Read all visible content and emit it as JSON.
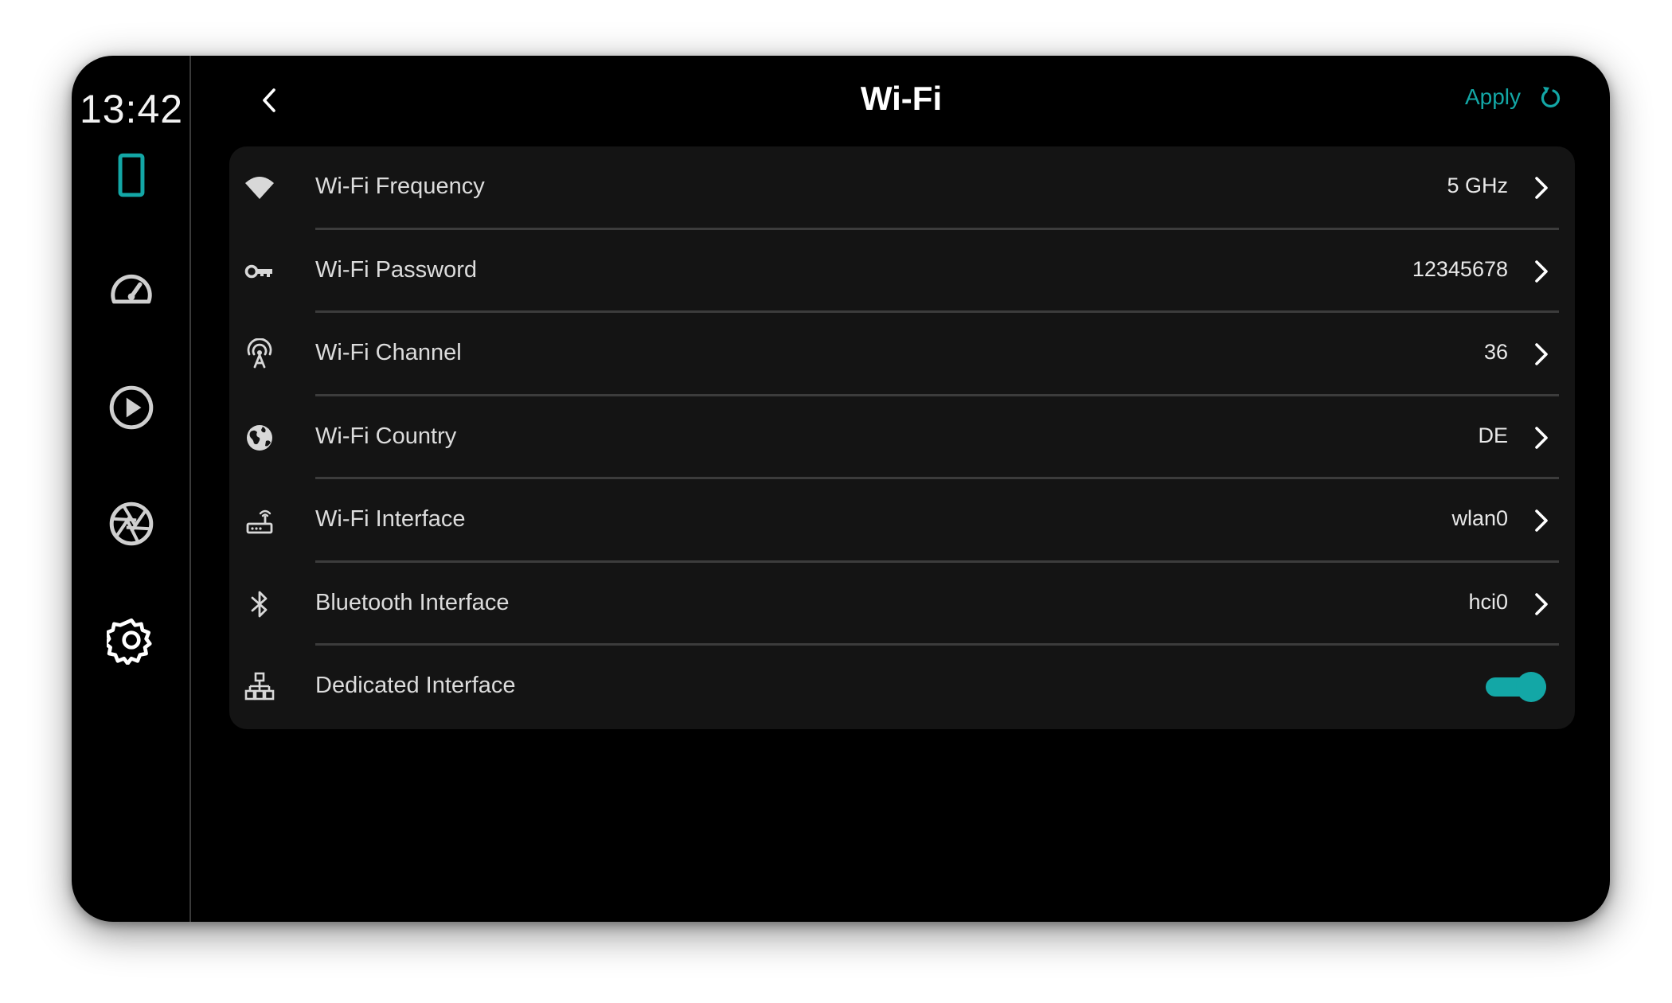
{
  "clock": "13:42",
  "accent_color": "#13a7a6",
  "rail": {
    "items": [
      {
        "icon": "tablet-icon",
        "active": true
      },
      {
        "icon": "speedometer-icon",
        "active": false
      },
      {
        "icon": "play-circle-icon",
        "active": false
      },
      {
        "icon": "camera-aperture-icon",
        "active": false
      },
      {
        "icon": "gear-icon",
        "active": false
      }
    ]
  },
  "header": {
    "title": "Wi-Fi",
    "back_icon": "chevron-left-icon",
    "apply_label": "Apply",
    "apply_icon": "refresh-icon"
  },
  "settings": {
    "rows": [
      {
        "icon": "wifi-icon",
        "label": "Wi-Fi Frequency",
        "value": "5 GHz"
      },
      {
        "icon": "key-icon",
        "label": "Wi-Fi Password",
        "value": "12345678"
      },
      {
        "icon": "broadcast-tower-icon",
        "label": "Wi-Fi Channel",
        "value": "36"
      },
      {
        "icon": "globe-icon",
        "label": "Wi-Fi Country",
        "value": "DE"
      },
      {
        "icon": "router-icon",
        "label": "Wi-Fi Interface",
        "value": "wlan0"
      },
      {
        "icon": "bluetooth-icon",
        "label": "Bluetooth Interface",
        "value": "hci0"
      },
      {
        "icon": "network-tree-icon",
        "label": "Dedicated Interface",
        "toggle_on": true
      }
    ]
  }
}
